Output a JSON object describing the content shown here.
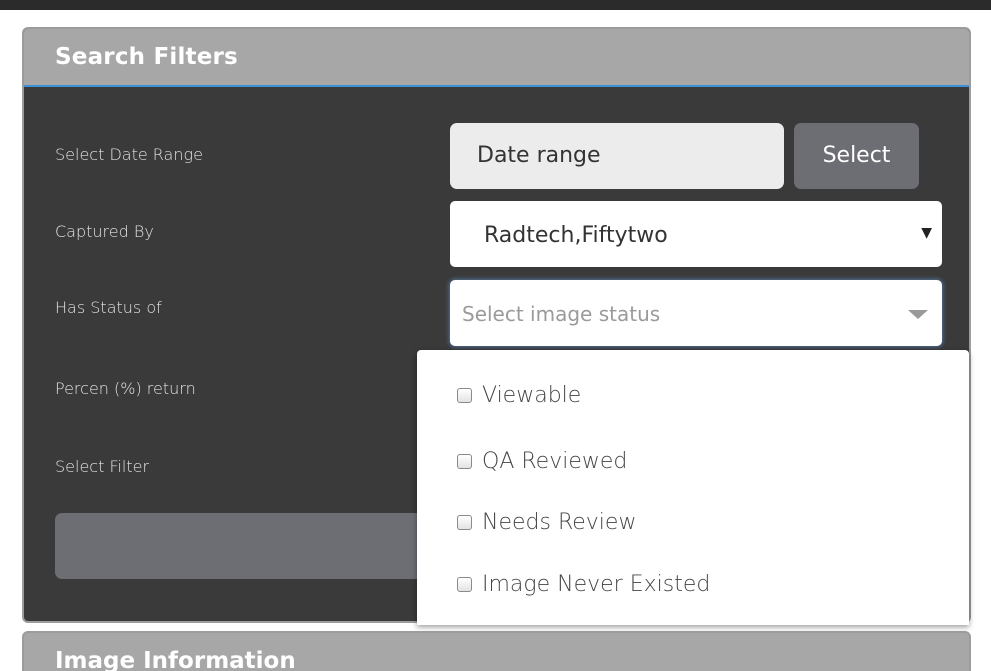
{
  "search_filters": {
    "title": "Search Filters",
    "date_range": {
      "label": "Select Date Range",
      "input_value": "Date range",
      "button_label": "Select"
    },
    "captured_by": {
      "label": "Captured By",
      "selected": "Radtech,Fiftytwo",
      "caret_icon": "▼"
    },
    "status": {
      "label": "Has Status of",
      "placeholder": "Select image status",
      "options": [
        {
          "label": "Viewable",
          "checked": false
        },
        {
          "label": "QA Reviewed",
          "checked": false
        },
        {
          "label": "Needs Review",
          "checked": false
        },
        {
          "label": "Image Never Existed",
          "checked": false
        }
      ]
    },
    "percent_return": {
      "label": "Percen (%) return"
    },
    "select_filter": {
      "label": "Select Filter"
    }
  },
  "image_information": {
    "title": "Image Information"
  },
  "colors": {
    "panel_bg": "#3a3a3a",
    "header_bg": "#a7a7a7",
    "accent_line": "#3d8fd6",
    "button_bg": "#6d6d74"
  }
}
